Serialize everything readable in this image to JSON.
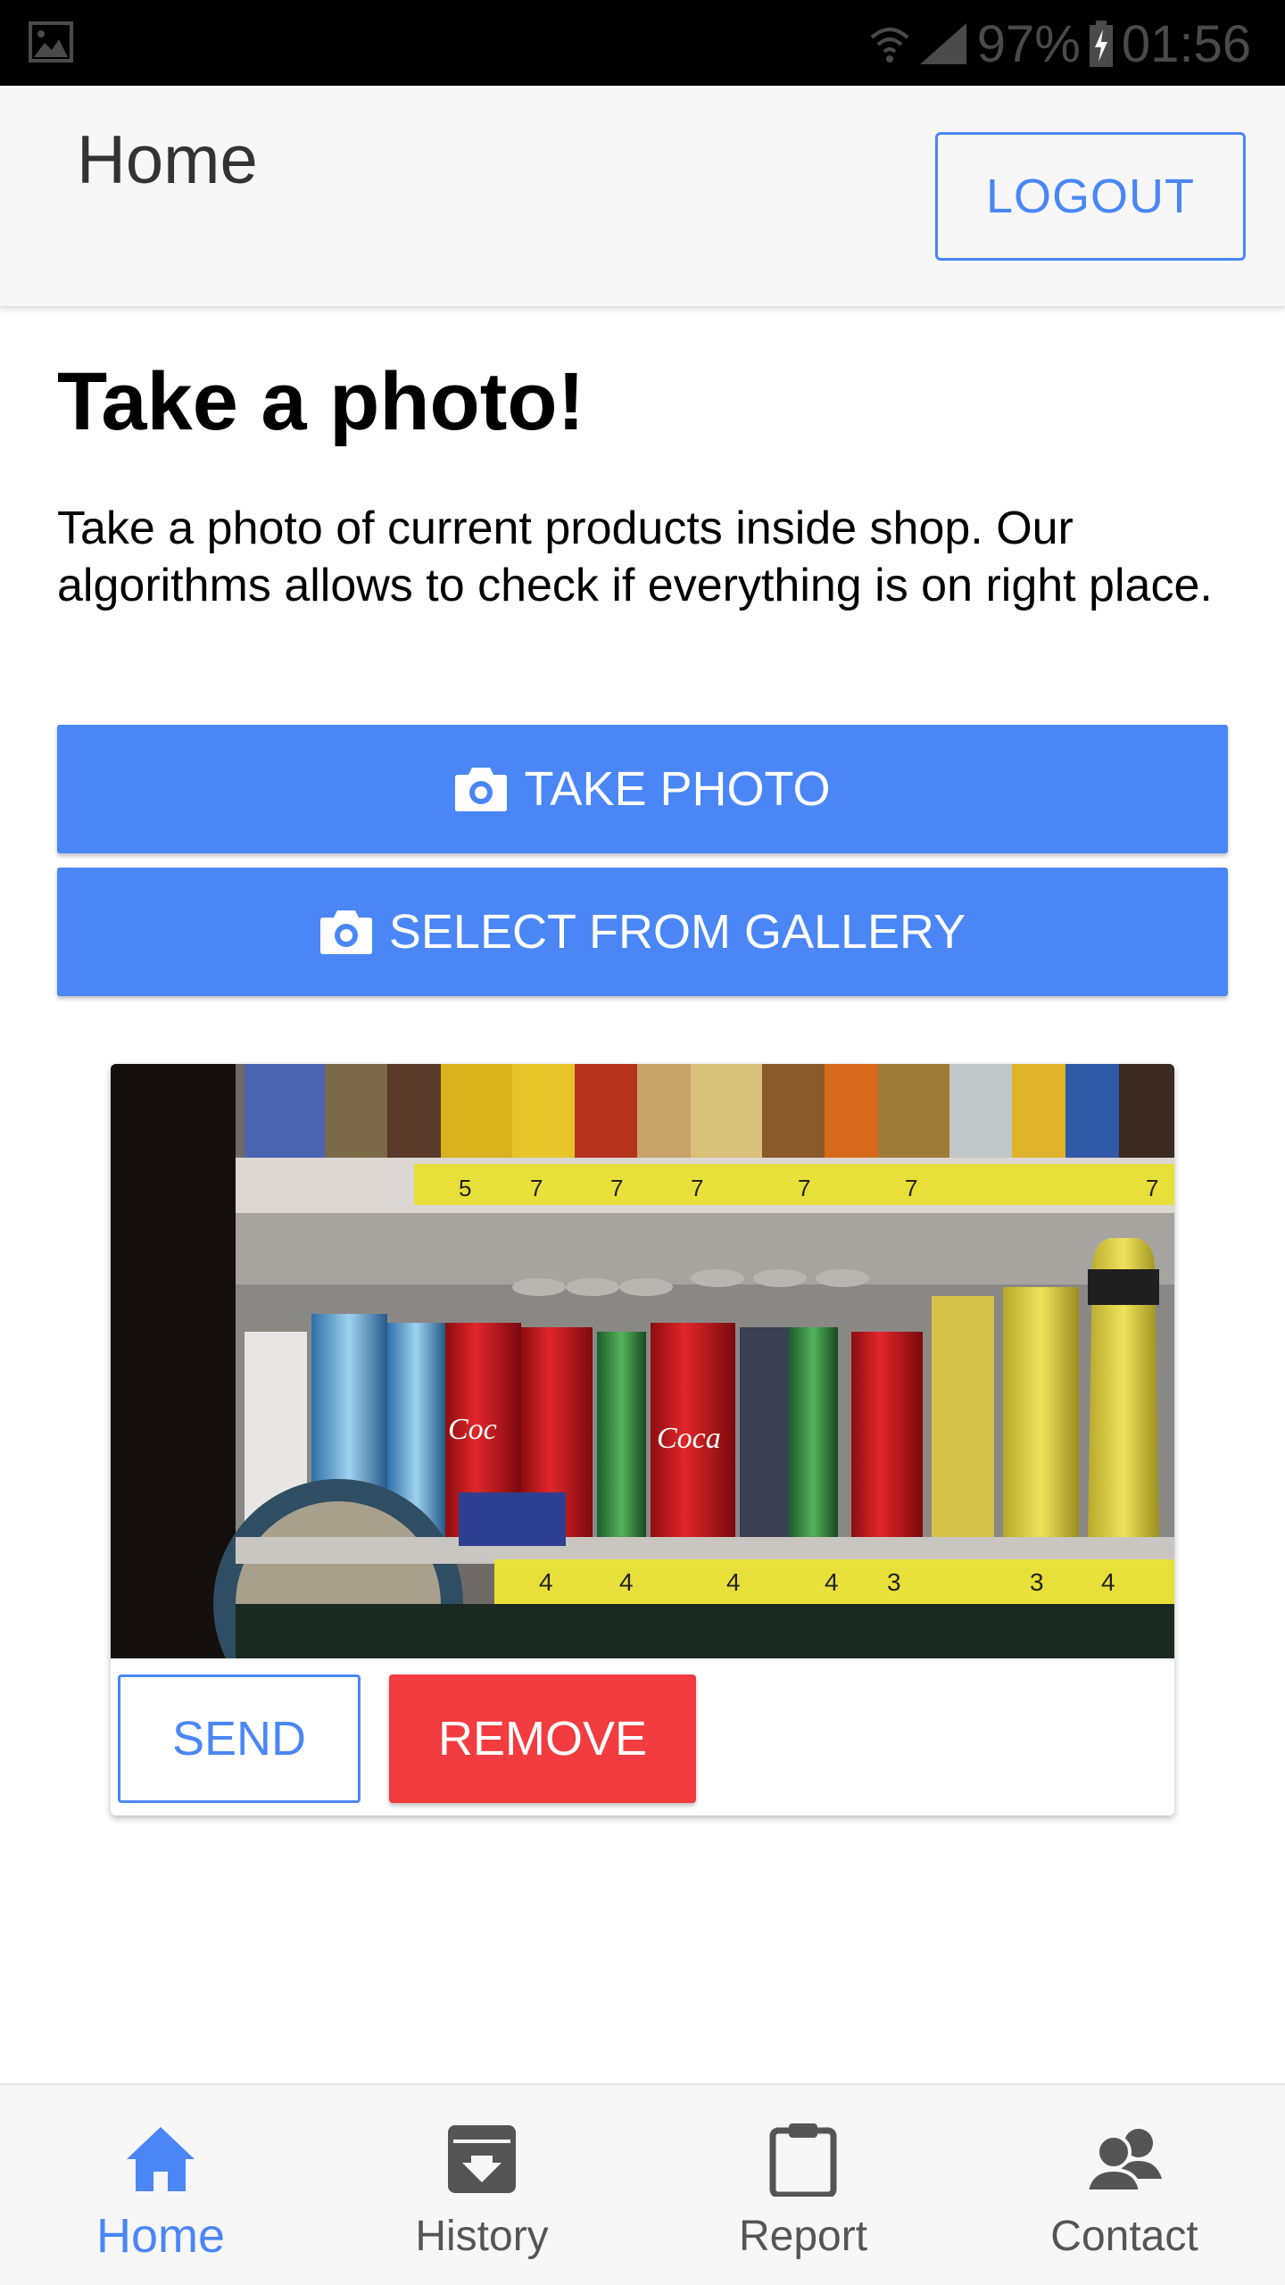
{
  "status_bar": {
    "battery": "97%",
    "time": "01:56",
    "icons": [
      "image-icon",
      "wifi-icon",
      "signal-icon",
      "battery-charging-icon"
    ]
  },
  "header": {
    "title": "Home",
    "logout_label": "LOGOUT"
  },
  "main": {
    "heading": "Take a photo!",
    "description": "Take a photo of current products inside shop. Our algorithms allows to check if everything is on right place.",
    "take_photo_label": "TAKE PHOTO",
    "gallery_label": "SELECT FROM GALLERY"
  },
  "photo_card": {
    "send_label": "SEND",
    "remove_label": "REMOVE"
  },
  "nav": {
    "items": [
      {
        "label": "Home",
        "icon": "home-icon",
        "active": true
      },
      {
        "label": "History",
        "icon": "archive-icon",
        "active": false
      },
      {
        "label": "Report",
        "icon": "clipboard-icon",
        "active": false
      },
      {
        "label": "Contact",
        "icon": "contacts-icon",
        "active": false
      }
    ]
  },
  "colors": {
    "primary": "#4a86f5",
    "danger": "#f23c3f",
    "header_bg": "#f7f7f7",
    "status_bar_bg": "#000000"
  }
}
